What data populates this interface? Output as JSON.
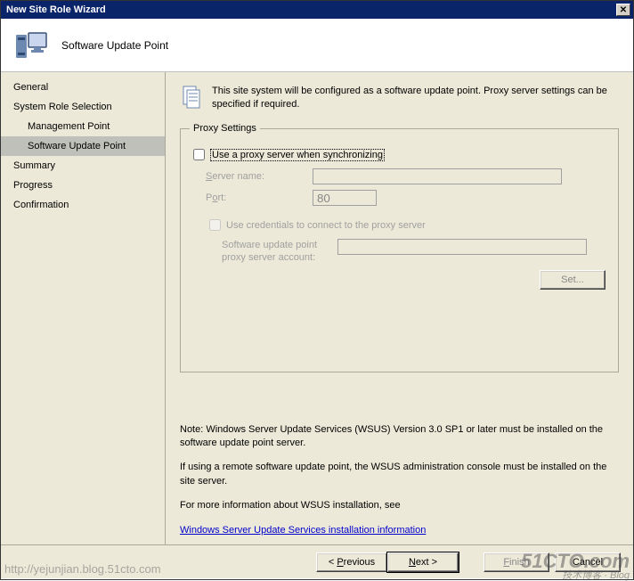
{
  "title": "New Site Role Wizard",
  "header": {
    "title": "Software Update Point"
  },
  "sidebar": {
    "items": [
      {
        "label": "General",
        "child": false
      },
      {
        "label": "System Role Selection",
        "child": false
      },
      {
        "label": "Management Point",
        "child": true
      },
      {
        "label": "Software Update Point",
        "child": true,
        "selected": true
      },
      {
        "label": "Summary",
        "child": false
      },
      {
        "label": "Progress",
        "child": false
      },
      {
        "label": "Confirmation",
        "child": false
      }
    ]
  },
  "content": {
    "info": "This site system will be configured as a software update point. Proxy server settings can be specified if required.",
    "proxy": {
      "legend": "Proxy Settings",
      "use_proxy_label": "Use a proxy server when synchronizing",
      "server_label": "Server name:",
      "server_value": "",
      "port_label": "Port:",
      "port_value": "80",
      "use_creds_label": "Use credentials to connect to the proxy server",
      "account_label": "Software update point proxy server account:",
      "account_value": "",
      "set_btn": "Set..."
    },
    "notes": {
      "n1": "Note: Windows Server Update Services (WSUS) Version 3.0 SP1 or later must be installed on the software update point server.",
      "n2": "If using a remote software update point, the WSUS administration console must be installed on the site server.",
      "n3": "For more information about WSUS installation, see",
      "link": "Windows Server Update Services installation information"
    }
  },
  "footer": {
    "prev": "Previous",
    "next": "Next",
    "finish": "Finish",
    "cancel": "Cancel"
  },
  "watermark": {
    "big": "51CTO.com",
    "small": "技术博客 · Blog"
  },
  "url_wm": "http://yejunjian.blog.51cto.com"
}
